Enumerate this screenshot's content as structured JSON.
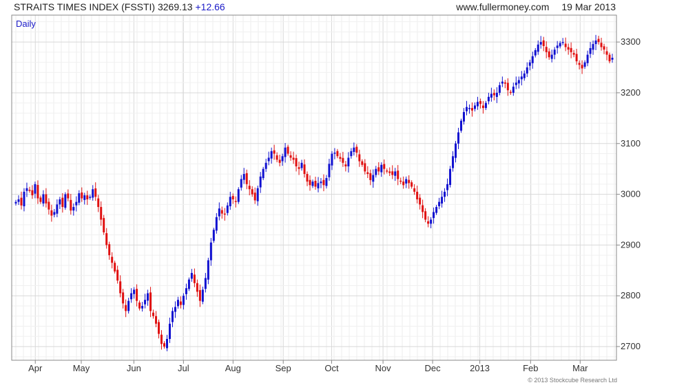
{
  "header": {
    "index_name": "STRAITS TIMES INDEX (FSSTI)",
    "last_value": "3269.13",
    "change": "+12.66",
    "website": "www.fullermoney.com",
    "date": "19 Mar 2013"
  },
  "period_label": "Daily",
  "copyright": "© 2013 Stockcube Research Ltd",
  "colors": {
    "up": "#1010d0",
    "down": "#e01010",
    "grid": "#d8d8d8",
    "frame": "#888888"
  },
  "chart_data": {
    "type": "candlestick",
    "x_tick_labels": [
      "Apr",
      "May",
      "Jun",
      "Jul",
      "Aug",
      "Sep",
      "Oct",
      "Nov",
      "Dec",
      "2013",
      "Feb",
      "Mar"
    ],
    "y_ticks": [
      2700,
      2800,
      2900,
      3000,
      3100,
      3200,
      3300
    ],
    "ylim": [
      2673,
      3353
    ],
    "grid": true,
    "close_series": [
      2985,
      2990,
      2978,
      3005,
      3012,
      3008,
      2998,
      3020,
      2992,
      2985,
      3000,
      2982,
      2970,
      2958,
      2965,
      2980,
      2990,
      2975,
      3000,
      2992,
      2968,
      2975,
      2985,
      3002,
      2992,
      2998,
      2990,
      2995,
      3010,
      2995,
      2975,
      2950,
      2925,
      2900,
      2880,
      2865,
      2848,
      2830,
      2805,
      2785,
      2770,
      2790,
      2805,
      2812,
      2790,
      2775,
      2780,
      2792,
      2805,
      2770,
      2760,
      2745,
      2725,
      2705,
      2700,
      2715,
      2745,
      2770,
      2778,
      2792,
      2782,
      2800,
      2815,
      2832,
      2845,
      2825,
      2808,
      2790,
      2812,
      2835,
      2870,
      2905,
      2930,
      2955,
      2972,
      2962,
      2960,
      2978,
      2995,
      2990,
      2985,
      3010,
      3030,
      3040,
      3020,
      3010,
      3000,
      2988,
      3012,
      3035,
      3050,
      3062,
      3072,
      3085,
      3080,
      3068,
      3062,
      3075,
      3092,
      3080,
      3072,
      3068,
      3055,
      3050,
      3062,
      3040,
      3025,
      3018,
      3025,
      3015,
      3022,
      3025,
      3018,
      3032,
      3060,
      3080,
      3082,
      3075,
      3070,
      3062,
      3055,
      3072,
      3085,
      3092,
      3082,
      3065,
      3058,
      3045,
      3040,
      3028,
      3038,
      3050,
      3045,
      3058,
      3050,
      3045,
      3042,
      3038,
      3045,
      3030,
      3025,
      3018,
      3030,
      3022,
      3015,
      3005,
      2990,
      2980,
      2965,
      2950,
      2942,
      2950,
      2965,
      2975,
      2985,
      2995,
      3005,
      3020,
      3050,
      3075,
      3100,
      3122,
      3145,
      3162,
      3172,
      3170,
      3165,
      3175,
      3182,
      3178,
      3170,
      3180,
      3192,
      3198,
      3195,
      3200,
      3215,
      3222,
      3218,
      3205,
      3200,
      3212,
      3220,
      3225,
      3232,
      3238,
      3250,
      3260,
      3272,
      3284,
      3295,
      3300,
      3292,
      3280,
      3270,
      3275,
      3285,
      3293,
      3298,
      3300,
      3290,
      3285,
      3280,
      3275,
      3262,
      3255,
      3248,
      3260,
      3275,
      3288,
      3296,
      3303,
      3300,
      3290,
      3285,
      3275,
      3262,
      3269
    ]
  }
}
